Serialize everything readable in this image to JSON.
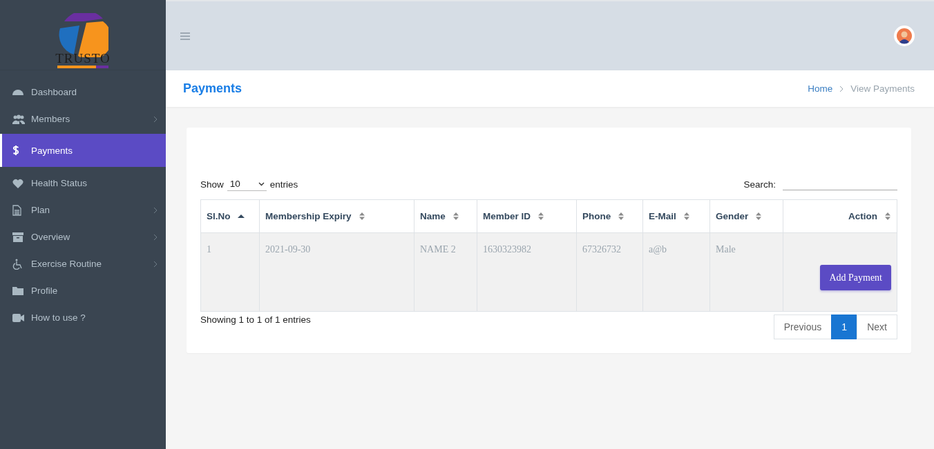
{
  "logo": {
    "text": "TRUSTO"
  },
  "sidebar": {
    "items": [
      {
        "label": "Dashboard",
        "selected": false,
        "submenu": false
      },
      {
        "label": "Members",
        "selected": false,
        "submenu": true
      },
      {
        "label": "Payments",
        "selected": true,
        "submenu": false
      },
      {
        "label": "Health Status",
        "selected": false,
        "submenu": false
      },
      {
        "label": "Plan",
        "selected": false,
        "submenu": true
      },
      {
        "label": "Overview",
        "selected": false,
        "submenu": true
      },
      {
        "label": "Exercise Routine",
        "selected": false,
        "submenu": true
      },
      {
        "label": "Profile",
        "selected": false,
        "submenu": false
      },
      {
        "label": "How to use ?",
        "selected": false,
        "submenu": false
      }
    ]
  },
  "page_title": "Payments",
  "breadcrumb": [
    "Home",
    "View Payments"
  ],
  "table_controls": {
    "show_label": "Show",
    "page_size": "10",
    "entries_label": "entries",
    "search_label": "Search:"
  },
  "table": {
    "columns": [
      {
        "label": "Sl.No",
        "sorted": true
      },
      {
        "label": "Membership Expiry",
        "sorted": false
      },
      {
        "label": "Name",
        "sorted": false
      },
      {
        "label": "Member ID",
        "sorted": false
      },
      {
        "label": "Phone",
        "sorted": false
      },
      {
        "label": "E-Mail",
        "sorted": false
      },
      {
        "label": "Gender",
        "sorted": false
      },
      {
        "label": "Action",
        "sorted": false
      }
    ],
    "rows": [
      {
        "cells": [
          "1",
          "2021-09-30",
          "NAME 2",
          "1630323982",
          "67326732",
          "a@b",
          "Male"
        ],
        "action": "Add Payment"
      }
    ]
  },
  "info": "Showing 1 to 1 of 1 entries",
  "pagination": [
    {
      "label": "Previous",
      "kind": "prev",
      "selected": false
    },
    {
      "label": "1",
      "kind": "page",
      "selected": true
    },
    {
      "label": "Next",
      "kind": "next",
      "selected": false
    }
  ]
}
